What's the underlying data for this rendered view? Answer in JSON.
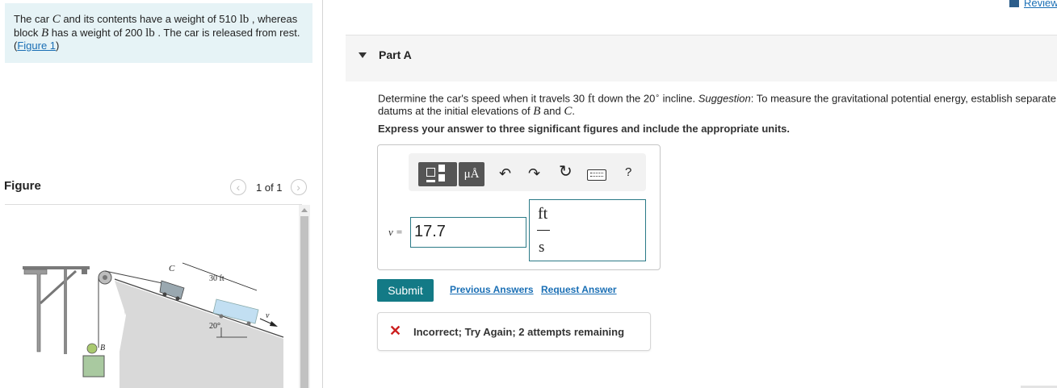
{
  "problem": {
    "text_1": "The car ",
    "car_var": "C",
    "text_2": " and its contents have a weight of 510 ",
    "unit_lb": "lb",
    "text_3": " , whereas block ",
    "block_var": "B",
    "text_4": " has a weight of 200 ",
    "text_5": " . The car is released from rest. (",
    "figure_link": "Figure 1",
    "text_6": ")"
  },
  "figure": {
    "heading": "Figure",
    "counter": "1 of 1",
    "prev_icon": "chevron-left-icon",
    "next_icon": "chevron-right-icon",
    "labels": {
      "c": "C",
      "distance": "30 ft",
      "angle": "20°",
      "v": "v",
      "b": "B"
    }
  },
  "review": {
    "label": "Review",
    "icon": "book-icon"
  },
  "part": {
    "title": "Part A"
  },
  "question": {
    "t1": "Determine the car's speed when it travels 30 ",
    "unit_ft": "ft",
    "t2": " down the 20",
    "deg": "∘",
    "t3": " incline. ",
    "suggestion": "Suggestion",
    "t4": ": To measure the gravitational potential energy, establish separate",
    "t5": "datums at the initial elevations of ",
    "var_b": "B",
    "t6": " and ",
    "var_c": "C",
    "t7": "."
  },
  "instruction": "Express your answer to three significant figures and include the appropriate units.",
  "toolbar": {
    "units_label": "μÅ",
    "undo_glyph": "↶",
    "redo_glyph": "↷",
    "reset_glyph": "↻",
    "help_label": "?"
  },
  "answer": {
    "variable_label": "v =",
    "value": "17.7",
    "unit_numerator": "ft",
    "unit_denominator": "s"
  },
  "actions": {
    "submit": "Submit",
    "previous_answers": "Previous Answers",
    "request_answer": "Request Answer"
  },
  "feedback": {
    "icon": "✕",
    "text": "Incorrect; Try Again; 2 attempts remaining",
    "color": "#cc1f1f"
  },
  "colors": {
    "accent": "#137a86",
    "link": "#1a6fb5",
    "problem_bg": "#e6f3f6"
  }
}
